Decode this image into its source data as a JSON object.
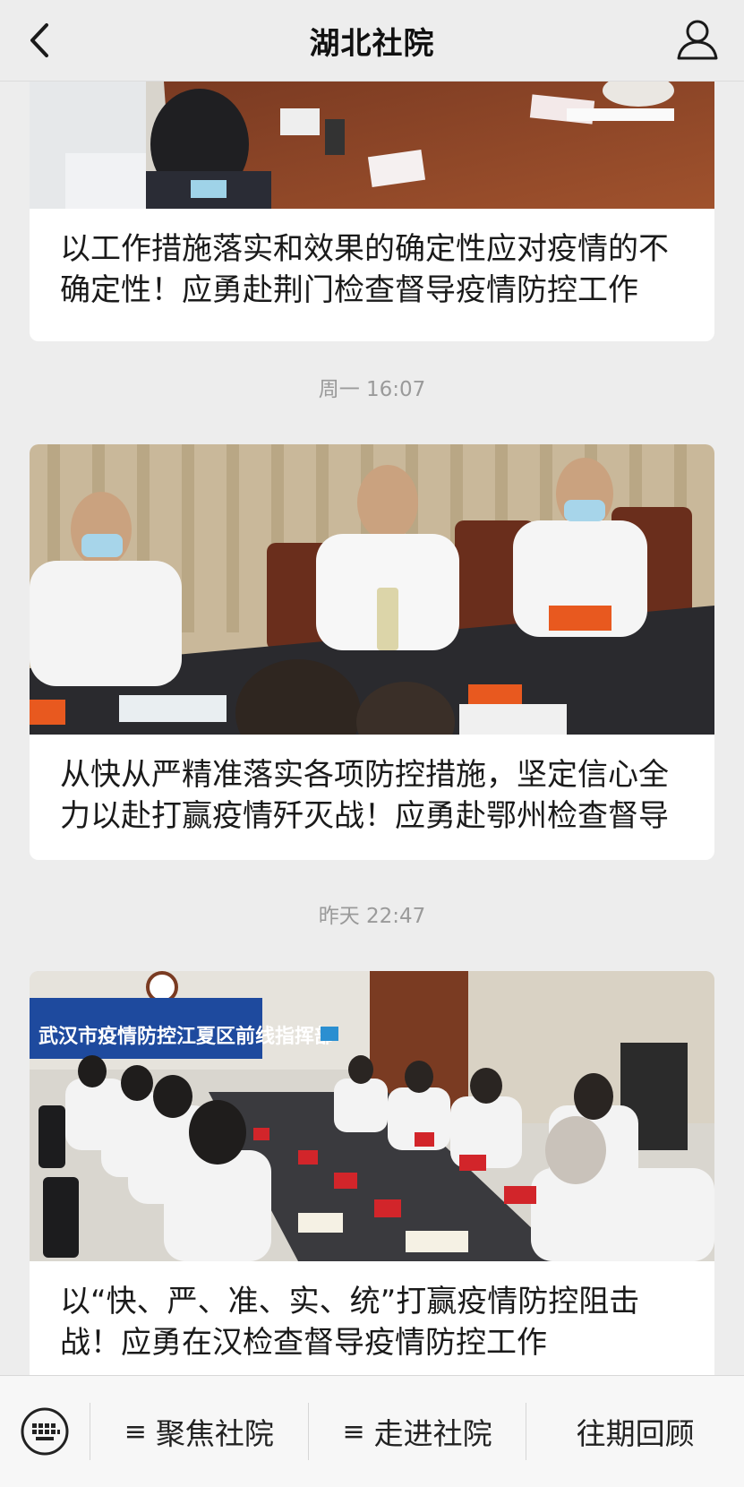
{
  "header": {
    "title": "湖北社院",
    "back_icon": "chevron-left-icon",
    "user_icon": "user-icon"
  },
  "feed": {
    "articles": [
      {
        "title": "以工作措施落实和效果的确定性应对疫情的不确定性！应勇赴荆门检查督导疫情防控工作",
        "image": "meeting-photo-placards"
      },
      {
        "timestamp": "周一 16:07",
        "title": "从快从严精准落实各项防控措施，坚定信心全力以赴打赢疫情歼灭战！应勇赴鄂州检查督导",
        "image": "meeting-photo-officials"
      },
      {
        "timestamp": "昨天 22:47",
        "title": "以“快、严、准、实、统”打赢疫情防控阻击战！应勇在汉检查督导疫情防控工作",
        "image": "meeting-photo-banner",
        "banner_text": "武汉市疫情防控江夏区前线指挥部"
      }
    ]
  },
  "menu": {
    "keyboard_icon": "keyboard-icon",
    "items": [
      {
        "label": "聚焦社院",
        "has_submenu": true
      },
      {
        "label": "走进社院",
        "has_submenu": true
      },
      {
        "label": "往期回顾",
        "has_submenu": false
      }
    ],
    "submenu_glyph": "≡"
  }
}
